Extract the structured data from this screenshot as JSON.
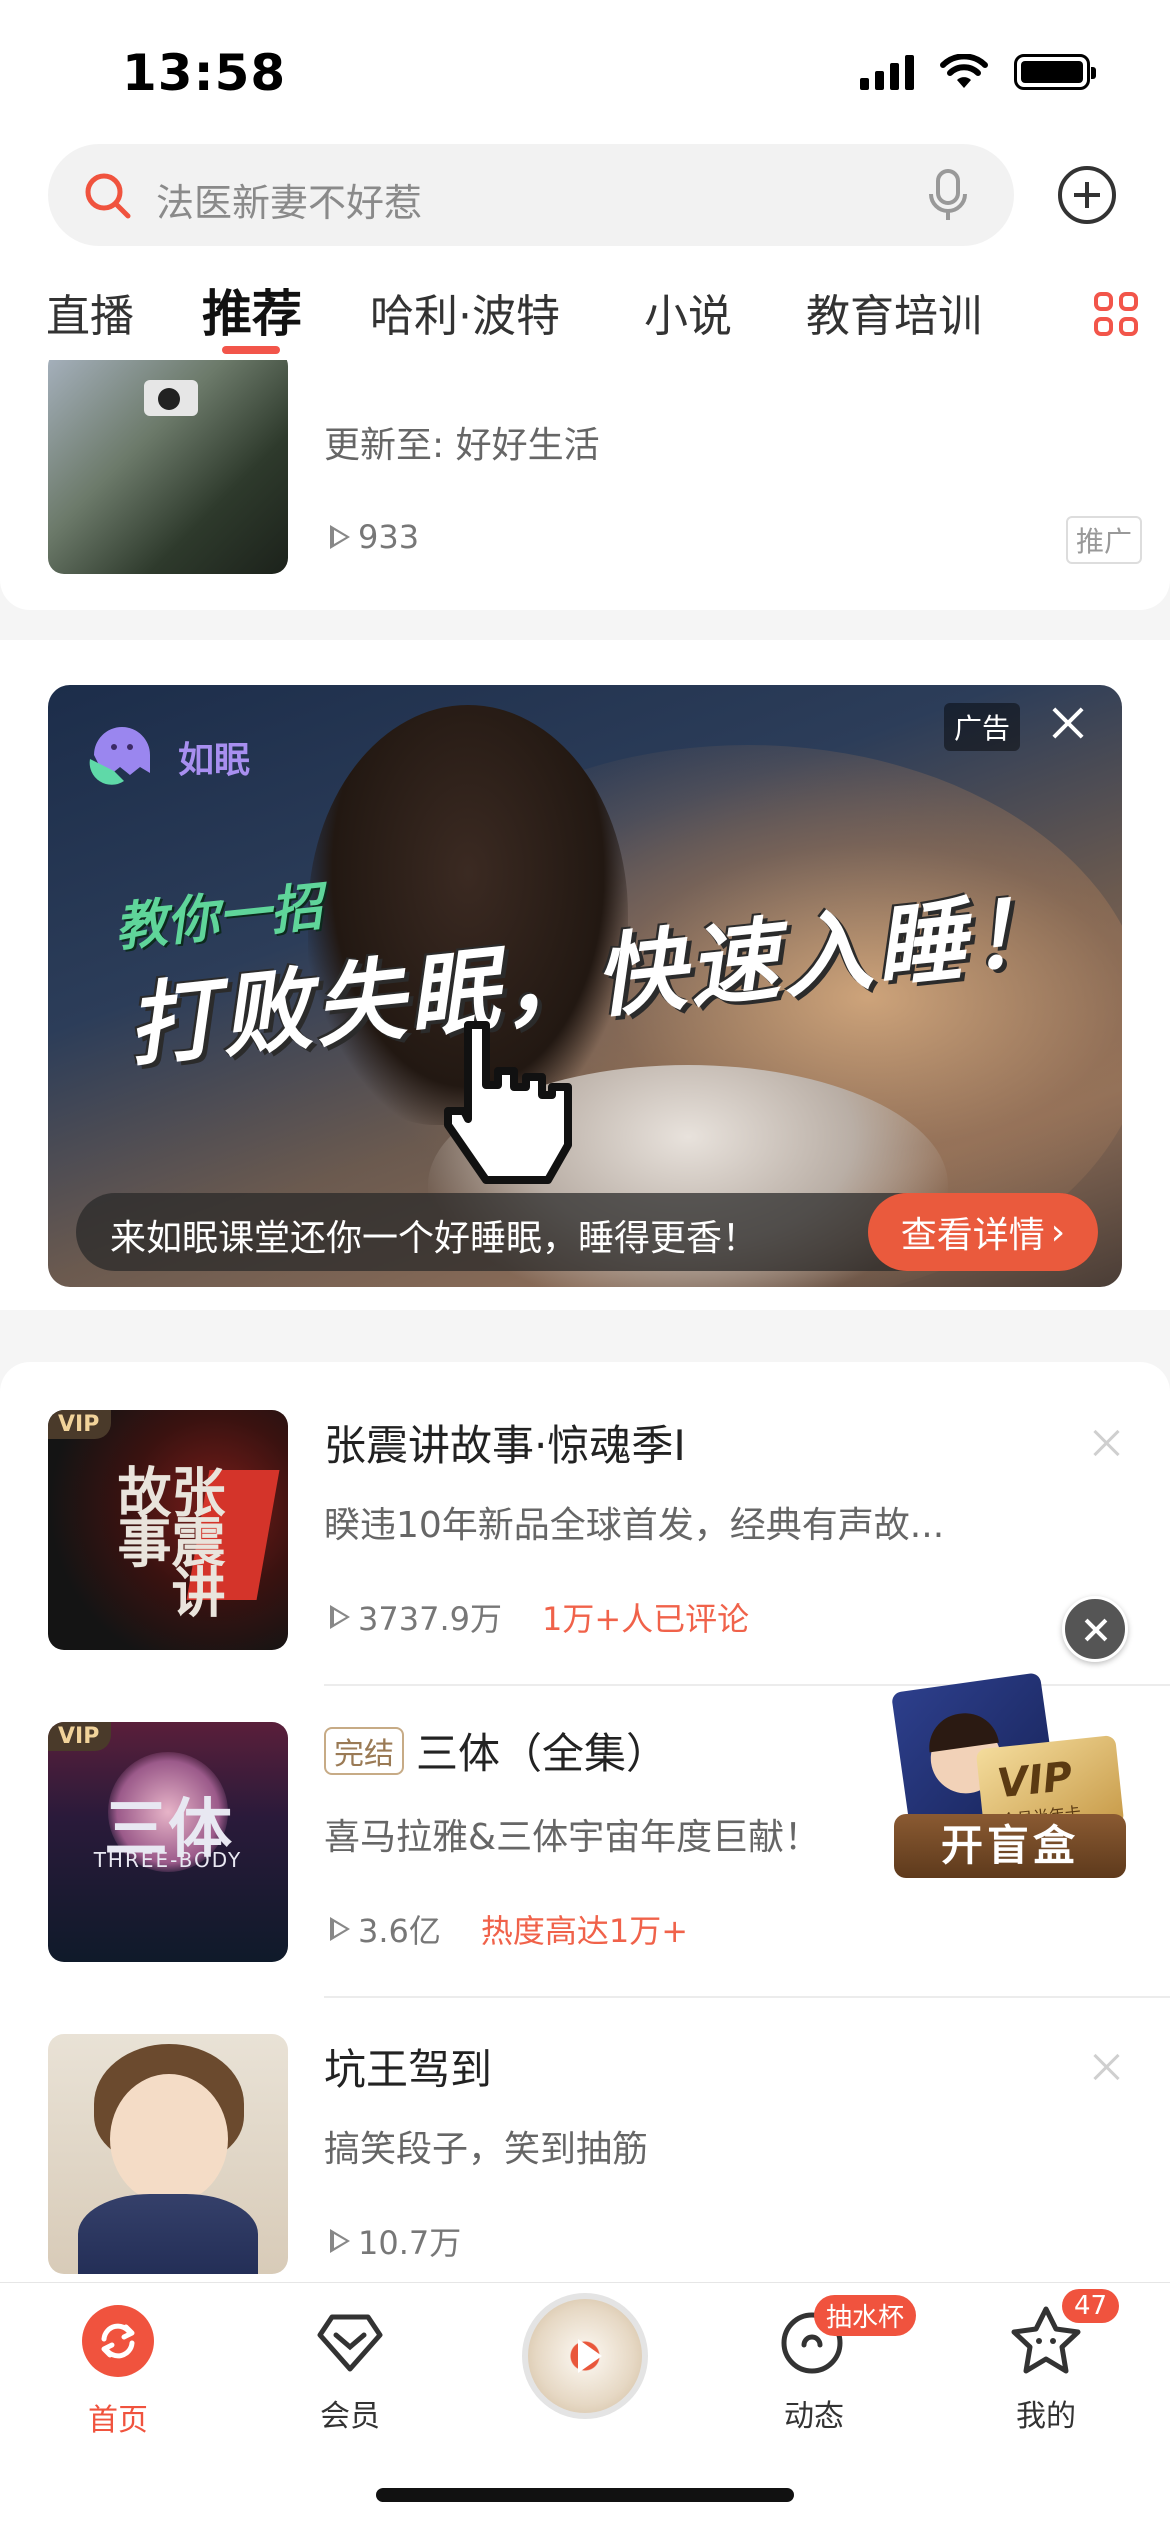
{
  "status_bar": {
    "time": "13:58"
  },
  "search": {
    "placeholder": "法医新妻不好惹"
  },
  "tabs": [
    {
      "label": "直播"
    },
    {
      "label": "推荐",
      "active": true
    },
    {
      "label": "哈利·波特"
    },
    {
      "label": "小说"
    },
    {
      "label": "教育培训"
    }
  ],
  "top_card": {
    "subtitle": "更新至: 好好生活",
    "plays": "933",
    "tag": "推广"
  },
  "ad": {
    "brand": "如眠",
    "tag": "广告",
    "subhead": "教你一招",
    "headline": "打败失眠，快速入睡！",
    "caption": "来如眠课堂还你一个好睡眠，睡得更香！",
    "cta": "查看详情"
  },
  "list": [
    {
      "badge": "VIP",
      "cover_text": "张震讲故事",
      "title": "张震讲故事·惊魂季I",
      "desc": "睽违10年新品全球首发，经典有声故...",
      "plays": "3737.9万",
      "highlight": "1万+人已评论"
    },
    {
      "badge": "VIP",
      "status": "完结",
      "cover_text": "三体",
      "cover_sub": "THREE-BODY",
      "title": "三体（全集）",
      "desc": "喜马拉雅&三体宇宙年度巨献！",
      "plays": "3.6亿",
      "highlight": "热度高达1万+"
    },
    {
      "title": "坑王驾到",
      "desc": "搞笑段子，笑到抽筋",
      "plays": "10.7万"
    }
  ],
  "promo": {
    "vip": "VIP",
    "vip_sub": "会员半年卡",
    "button": "开盲盒"
  },
  "bottom_nav": [
    {
      "label": "首页",
      "active": true,
      "icon": "refresh-icon"
    },
    {
      "label": "会员",
      "icon": "diamond-icon"
    },
    {
      "label": "",
      "icon": "play-disc-icon"
    },
    {
      "label": "动态",
      "icon": "dynamic-icon",
      "badge": "抽水杯"
    },
    {
      "label": "我的",
      "icon": "star-face-icon",
      "badge": "47"
    }
  ],
  "colors": {
    "accent": "#f0533e",
    "highlight": "#f0624a"
  }
}
